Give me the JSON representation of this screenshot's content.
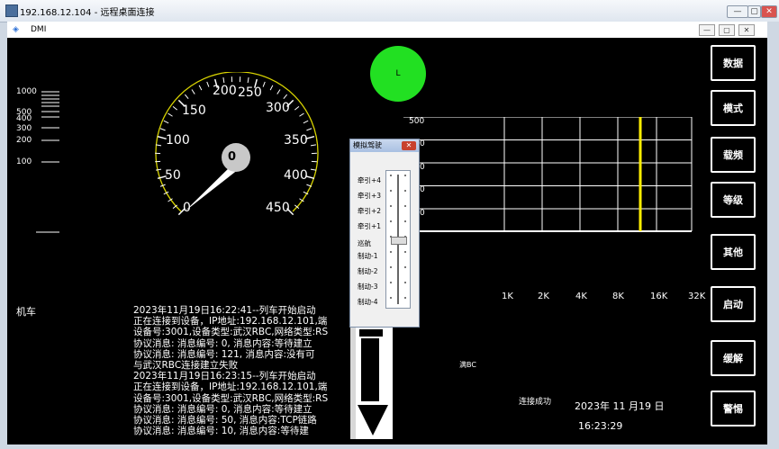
{
  "remote_title": "192.168.12.104 - 远程桌面连接",
  "remote_ctrls": [
    "—",
    "▢",
    "✕"
  ],
  "dmi_title": "DMI",
  "dmi_logo": "DMI-logo-icon",
  "dmi_ctrls": [
    "—",
    "▢",
    "✕"
  ],
  "side_buttons": [
    "数据",
    "模式",
    "载频",
    "等级",
    "其他",
    "启动",
    "缓解",
    "警惕"
  ],
  "lamp_label": "L",
  "speed": {
    "value": "0",
    "ticks": [
      "0",
      "50",
      "100",
      "150",
      "200",
      "250",
      "300",
      "350",
      "400",
      "450"
    ]
  },
  "distance_scale": [
    "1000",
    "500",
    "400",
    "300",
    "200",
    "100"
  ],
  "planning_top_value": "500",
  "planning_x_ticks": [
    "1K",
    "2K",
    "4K",
    "8K",
    "16K",
    "32K"
  ],
  "planning_y_partial": [
    "0",
    "0",
    "0",
    "0"
  ],
  "locomotive_label": "机车",
  "rbc_label": "满BC",
  "connect_status": "连接成功",
  "date_text": "2023年  11 月19  日",
  "time_text": "16:23:29",
  "log_lines": [
    "2023年11月19日16:22:41--列车开始启动",
    "正在连接到设备，IP地址:192.168.12.101,端",
    "设备号:3001,设备类型:武汉RBC,网络类型:RS",
    "协议消息: 消息编号: 0, 消息内容:等待建立",
    "协议消息: 消息编号: 121, 消息内容:没有可",
    "与武汉RBC连接建立失败",
    "2023年11月19日16:23:15--列车开始启动",
    "正在连接到设备，IP地址:192.168.12.101,端",
    "设备号:3001,设备类型:武汉RBC,网络类型:RS",
    "协议消息: 消息编号: 0, 消息内容:等待建立",
    "协议消息: 消息编号: 50, 消息内容:TCP链路",
    "协议消息: 消息编号: 10, 消息内容:等待建"
  ],
  "sim_window": {
    "title": "模拟驾驶",
    "close": "✕",
    "notches": [
      "牵引+4",
      "牵引+3",
      "牵引+2",
      "牵引+1",
      "巡航",
      "制动-1",
      "制动-2",
      "制动-3",
      "制动-4"
    ],
    "selected": "巡航"
  },
  "colors": {
    "lamp": "#22e022",
    "gauge_ring": "#d9d400",
    "target_line": "#ffee00"
  }
}
